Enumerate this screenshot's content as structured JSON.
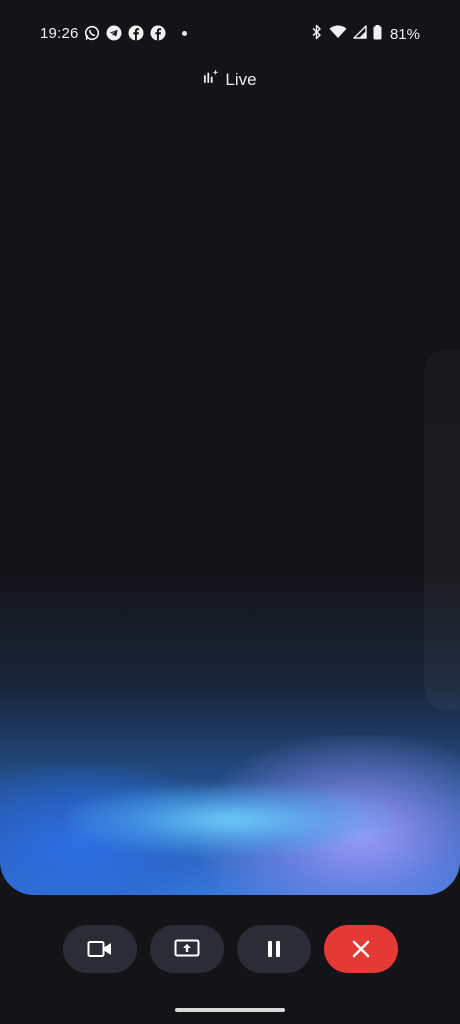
{
  "status_bar": {
    "time": "19:26",
    "notifications": [
      "whatsapp-icon",
      "telegram-icon",
      "facebook-icon",
      "facebook-icon"
    ],
    "system_icons": [
      "bluetooth-icon",
      "wifi-icon",
      "signal-icon",
      "battery-icon"
    ],
    "battery": "81%"
  },
  "header": {
    "title": "Live",
    "icon": "gemini-live-icon"
  },
  "controls": {
    "buttons": [
      {
        "name": "camera-button",
        "icon": "video-camera-icon"
      },
      {
        "name": "share-screen-button",
        "icon": "screen-share-icon"
      },
      {
        "name": "pause-button",
        "icon": "pause-icon"
      },
      {
        "name": "end-button",
        "icon": "close-icon"
      }
    ],
    "end_color": "#e53935",
    "button_color": "#2a2d35"
  },
  "colors": {
    "background": "#141418",
    "glow_blue": "#3778dc",
    "glow_cyan": "#6ed2ff",
    "glow_violet": "#aaa0ff"
  }
}
